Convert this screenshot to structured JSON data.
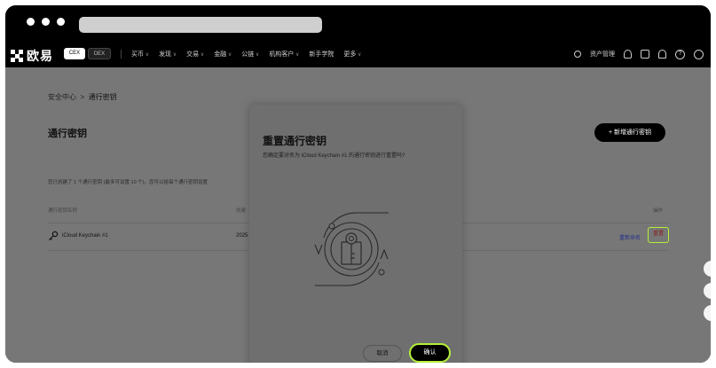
{
  "navbar": {
    "logo_text": "欧易",
    "cex_label": "CEX",
    "dex_label": "DEX",
    "menu": [
      "买币",
      "发现",
      "交易",
      "金融",
      "公链",
      "机构客户",
      "新手学院",
      "更多"
    ],
    "asset_mgmt_label": "资产管理"
  },
  "breadcrumb": {
    "parent": "安全中心",
    "separator": ">",
    "current": "通行密钥"
  },
  "page": {
    "title": "通行密钥",
    "add_button_label": "+ 新增通行密钥",
    "description": "您已创建了 1 个通行密钥 (最多可设置 10 个)。您可以给每个通行密钥设置",
    "table_headers": [
      "通行密钥名称",
      "创建",
      "",
      "操作"
    ],
    "rows": [
      {
        "name": "iCloud Keychain #1",
        "created": "2025",
        "rename_label": "重新命名",
        "reset_label": "重置"
      }
    ]
  },
  "modal": {
    "title": "重置通行密钥",
    "message": "您确定要对名为 iCloud Keychain #1 的通行密钥进行重置吗?",
    "cancel_label": "取消",
    "confirm_label": "确认"
  },
  "colors": {
    "accent": "#b5ef3a",
    "overlay_bg": "#777777",
    "modal_bg": "#6f6f6f"
  },
  "icons": [
    "search-icon",
    "user-icon",
    "download-icon",
    "bell-icon",
    "help-icon",
    "globe-icon",
    "key-icon",
    "refresh-lock-icon"
  ]
}
